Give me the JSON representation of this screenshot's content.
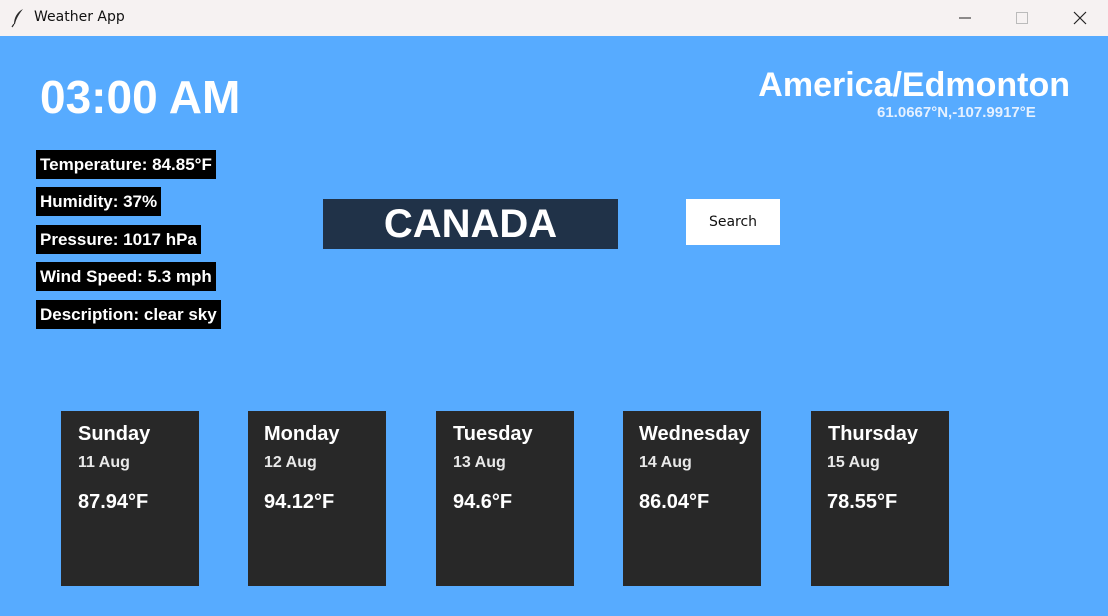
{
  "window": {
    "title": "Weather App",
    "icon": "feather-icon"
  },
  "clock": "03:00 AM",
  "location": {
    "timezone": "America/Edmonton",
    "coordinates": "61.0667°N,-107.9917°E"
  },
  "weather": {
    "temperature": "Temperature: 84.85°F",
    "humidity": "Humidity: 37%",
    "pressure": "Pressure: 1017 hPa",
    "wind_speed": "Wind Speed: 5.3 mph",
    "description": "Description: clear sky"
  },
  "search": {
    "value": "CANADA",
    "button_label": "Search"
  },
  "forecast": [
    {
      "day": "Sunday",
      "date": "11 Aug",
      "temp": "87.94°F"
    },
    {
      "day": "Monday",
      "date": "12 Aug",
      "temp": "94.12°F"
    },
    {
      "day": "Tuesday",
      "date": "13 Aug",
      "temp": "94.6°F"
    },
    {
      "day": "Wednesday",
      "date": "14 Aug",
      "temp": "86.04°F"
    },
    {
      "day": "Thursday",
      "date": "15 Aug",
      "temp": "78.55°F"
    }
  ],
  "colors": {
    "background": "#57abff",
    "card": "#282828",
    "search_box": "#203248",
    "info_label": "#000000"
  }
}
